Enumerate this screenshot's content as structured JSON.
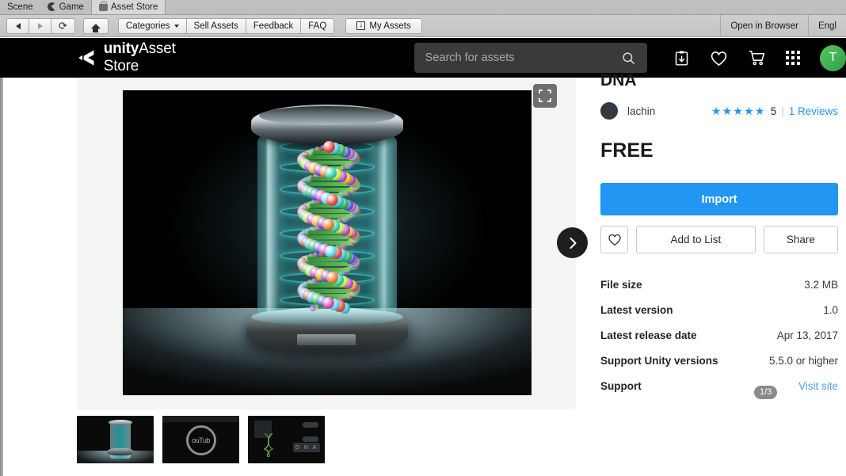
{
  "editor": {
    "tabs": [
      {
        "label": "Scene",
        "icon": "none",
        "active": false
      },
      {
        "label": "Game",
        "icon": "game-icon",
        "active": false
      },
      {
        "label": "Asset Store",
        "icon": "shopping-bag-icon",
        "active": true
      }
    ],
    "nav": {
      "back_icon": "back-arrow-icon",
      "forward_icon": "forward-arrow-icon",
      "reload_icon": "reload-icon",
      "home_icon": "home-icon"
    },
    "toolbar_buttons": [
      {
        "label": "Categories",
        "has_caret": true
      },
      {
        "label": "Sell Assets",
        "has_caret": false
      },
      {
        "label": "Feedback",
        "has_caret": false
      },
      {
        "label": "FAQ",
        "has_caret": false
      }
    ],
    "my_assets": {
      "label": "My Assets",
      "icon": "download-box-icon"
    },
    "right_buttons": [
      {
        "label": "Open in Browser"
      },
      {
        "label": "Engl"
      }
    ]
  },
  "header": {
    "logo": {
      "brand": "unity",
      "suffix": "Asset Store",
      "icon": "unity-cube-icon"
    },
    "search": {
      "value": "",
      "placeholder": "Search for assets",
      "icon": "search-icon"
    },
    "icons": [
      {
        "name": "downloads-icon"
      },
      {
        "name": "wishlist-heart-icon"
      },
      {
        "name": "shopping-cart-icon"
      },
      {
        "name": "apps-grid-icon"
      }
    ],
    "avatar": {
      "initial": "T",
      "color": "#3da24f"
    }
  },
  "gallery": {
    "expand_icon": "fullscreen-expand-icon",
    "next_icon": "chevron-right-icon",
    "counter": "1/3",
    "thumbnails": [
      {
        "name": "thumbnail-dna-render",
        "type": "image"
      },
      {
        "name": "thumbnail-youtube-video",
        "type": "video",
        "watermark": "ouTub"
      },
      {
        "name": "thumbnail-dna-dark-scene",
        "type": "image",
        "label": "D N A"
      }
    ]
  },
  "asset": {
    "title": "DNA",
    "publisher": "lachin",
    "rating_stars": "★★★★★",
    "rating_value": "5",
    "rating_divider": "|",
    "reviews": "1 Reviews",
    "price": "FREE",
    "import_label": "Import",
    "favorite_icon": "heart-icon",
    "add_to_list_label": "Add to List",
    "share_label": "Share",
    "meta": [
      {
        "key": "File size",
        "value": "3.2 MB",
        "link": false
      },
      {
        "key": "Latest version",
        "value": "1.0",
        "link": false
      },
      {
        "key": "Latest release date",
        "value": "Apr 13, 2017",
        "link": false
      },
      {
        "key": "Support Unity versions",
        "value": "5.5.0 or higher",
        "link": false
      },
      {
        "key": "Support",
        "value": "Visit site",
        "link": true
      }
    ]
  }
}
